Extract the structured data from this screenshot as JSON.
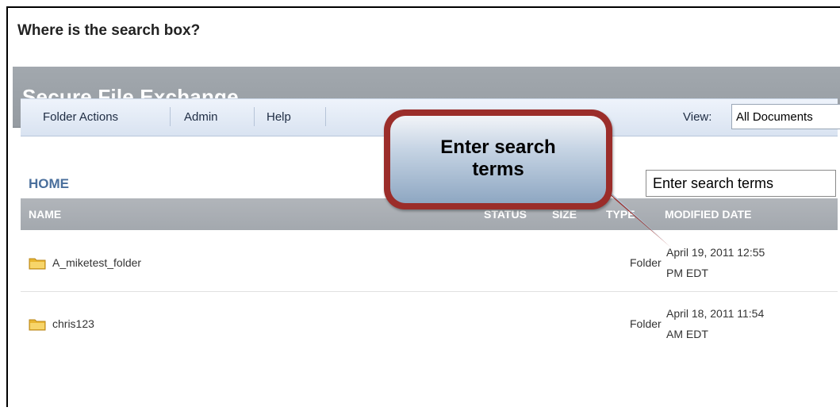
{
  "question": "Where is the search box?",
  "app": {
    "title": "Secure File Exchange"
  },
  "menu": {
    "items": [
      "Folder Actions",
      "Admin",
      "Help"
    ],
    "view_label": "View:",
    "view_value": "All Documents"
  },
  "home_label": "HOME",
  "search": {
    "value": "Enter search terms"
  },
  "callout": {
    "line1": "Enter search",
    "line2": "terms"
  },
  "table": {
    "columns": [
      "NAME",
      "STATUS",
      "SIZE",
      "TYPE",
      "MODIFIED DATE"
    ],
    "rows": [
      {
        "name": "A_miketest_folder",
        "type": "Folder",
        "date_line1": "April 19, 2011 12:55",
        "date_line2": "PM EDT",
        "icon": "folder-icon"
      },
      {
        "name": "chris123",
        "type": "Folder",
        "date_line1": "April 18, 2011 11:54",
        "date_line2": "AM EDT",
        "icon": "folder-icon"
      }
    ]
  },
  "colors": {
    "header_bg": "#9aa0a6",
    "menubar_bg": "#dde6f2",
    "callout_border": "#9b2d2a",
    "home_link": "#4a6f9c"
  }
}
